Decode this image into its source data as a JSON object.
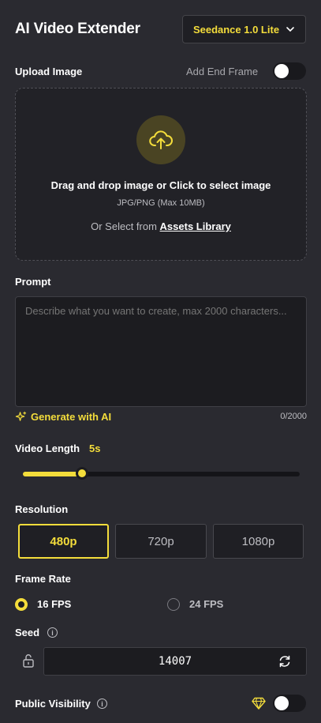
{
  "header": {
    "title": "AI Video Extender",
    "model_label": "Seedance 1.0 Lite"
  },
  "upload": {
    "label": "Upload Image",
    "end_frame_label": "Add End Frame",
    "end_frame_enabled": false,
    "drop_main": "Drag and drop image or Click to select image",
    "drop_sub": "JPG/PNG (Max 10MB)",
    "or_select": "Or Select from",
    "assets_link": "Assets Library"
  },
  "prompt": {
    "label": "Prompt",
    "placeholder": "Describe what you want to create, max 2000 characters...",
    "value": "",
    "generate_label": "Generate with AI",
    "counter": "0/2000"
  },
  "video_length": {
    "label": "Video Length",
    "value_text": "5s",
    "level_fraction": 0.22
  },
  "resolution": {
    "label": "Resolution",
    "options": [
      "480p",
      "720p",
      "1080p"
    ],
    "selected": "480p"
  },
  "frame_rate": {
    "label": "Frame Rate",
    "options": [
      "16 FPS",
      "24 FPS"
    ],
    "selected": "16 FPS"
  },
  "seed": {
    "label": "Seed",
    "value": "14007"
  },
  "visibility": {
    "label": "Public Visibility",
    "enabled": false
  },
  "colors": {
    "accent": "#f4dd3b",
    "background": "#2a2a30",
    "field": "#1c1c20"
  },
  "icons": [
    "chevron-down-icon",
    "upload-cloud-icon",
    "sparkle-icon",
    "info-icon",
    "unlock-icon",
    "refresh-icon",
    "diamond-icon"
  ]
}
